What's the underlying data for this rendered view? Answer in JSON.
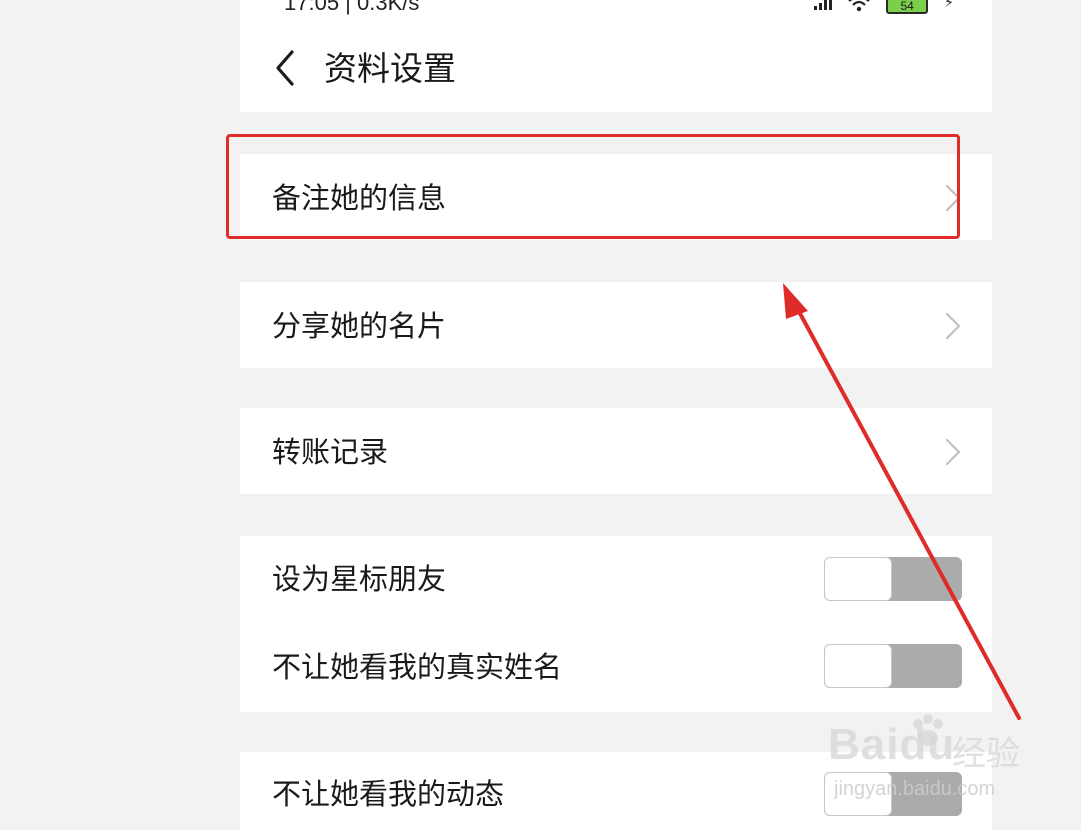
{
  "status_bar": {
    "time_speed": "17:05 | 0.3K/s",
    "battery": "54"
  },
  "header": {
    "title": "资料设置"
  },
  "menu": {
    "remark": "备注她的信息",
    "share_card": "分享她的名片",
    "transfer_records": "转账记录",
    "star_friend": "设为星标朋友",
    "hide_real_name": "不让她看我的真实姓名",
    "hide_moments": "不让她看我的动态"
  },
  "toggles": {
    "star_friend": "off",
    "hide_real_name": "off",
    "hide_moments": "off"
  },
  "annotation": {
    "box_color": "#e02b2b",
    "arrow_color": "#e02b2b"
  },
  "watermark": {
    "brand": "Baidu",
    "brand_cn": "经验",
    "url": "jingyan.baidu.com"
  }
}
